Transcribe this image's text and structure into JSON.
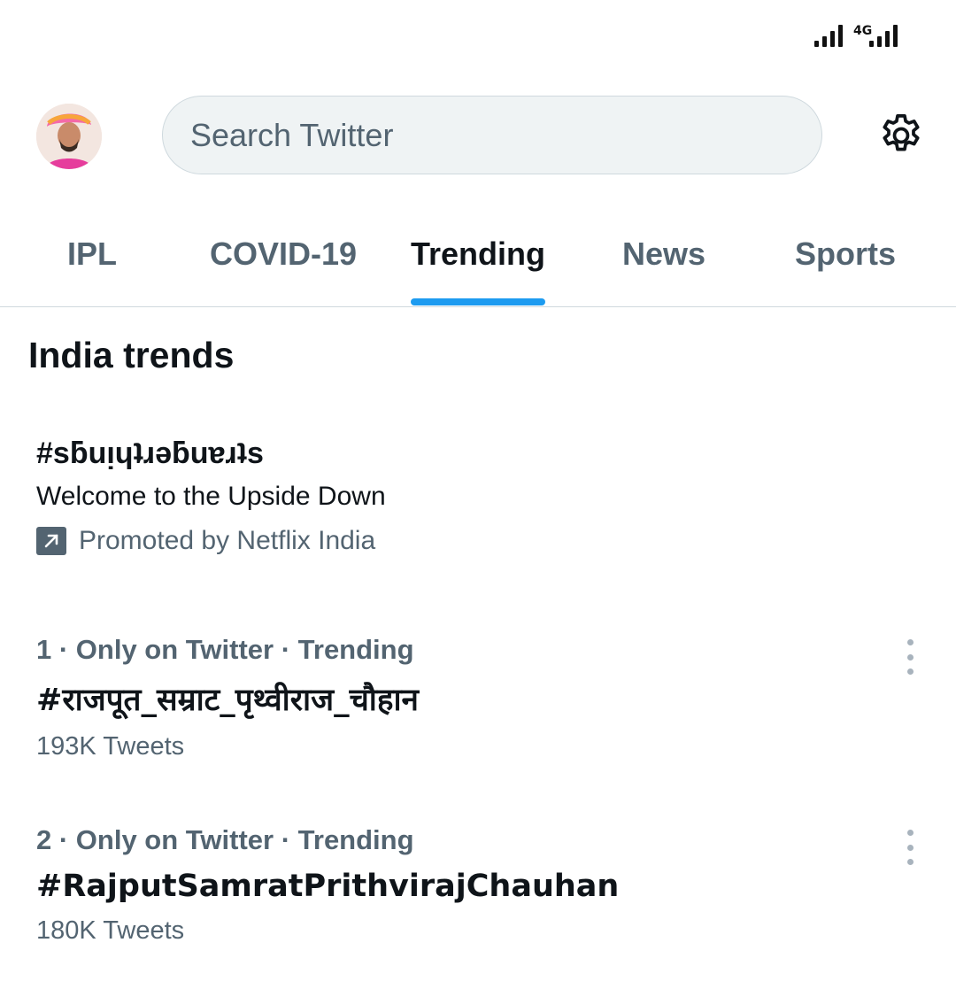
{
  "status_bar": {
    "network": "4G"
  },
  "header": {
    "search_placeholder": "Search Twitter",
    "avatar_icon": "user-avatar",
    "settings_icon": "gear-icon"
  },
  "tabs": [
    {
      "label": "IPL",
      "active": false
    },
    {
      "label": "COVID-19",
      "active": false
    },
    {
      "label": "Trending",
      "active": true
    },
    {
      "label": "News",
      "active": false
    },
    {
      "label": "Sports",
      "active": false
    }
  ],
  "section_title": "India trends",
  "promoted": {
    "hashtag": "#sƃuᴉɥʇɹǝƃuɐɹʇs",
    "description": "Welcome to the Upside Down",
    "promoted_by": "Promoted by Netflix India"
  },
  "trends": [
    {
      "meta": "1 · Only on Twitter · Trending",
      "name": "#राजपूत_सम्राट_पृथ्वीराज_चौहान",
      "count": "193K Tweets"
    },
    {
      "meta": "2 · Only on Twitter · Trending",
      "name": "#RajputSamratPrithvirajChauhan",
      "count": "180K Tweets"
    }
  ],
  "colors": {
    "accent": "#1d9bf0",
    "secondary_text": "#536471",
    "primary_text": "#0f1419"
  }
}
